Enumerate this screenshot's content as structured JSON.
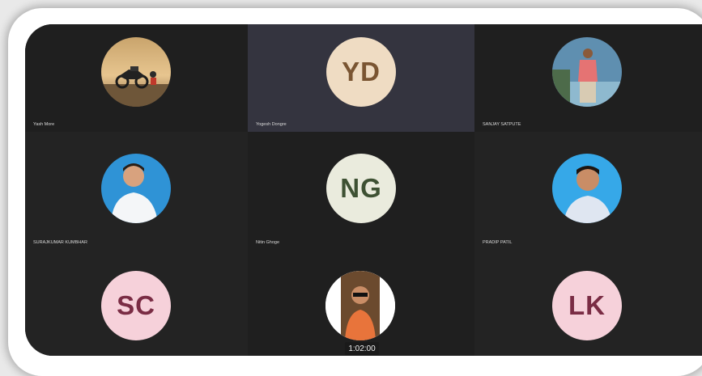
{
  "participants": [
    {
      "name": "Yash More",
      "initials": "",
      "avatar": "photo-motorbike"
    },
    {
      "name": "Yogesh Dongre",
      "initials": "YD",
      "avatar": "initials"
    },
    {
      "name": "SANJAY SATPUTE",
      "initials": "",
      "avatar": "photo-man-standing"
    },
    {
      "name": "SURAJKUMAR KUMBHAR",
      "initials": "",
      "avatar": "photo-man-smiling"
    },
    {
      "name": "Nitin Ghoge",
      "initials": "NG",
      "avatar": "initials"
    },
    {
      "name": "PRADIP PATIL",
      "initials": "",
      "avatar": "photo-man-portrait"
    },
    {
      "name": "",
      "initials": "SC",
      "avatar": "initials"
    },
    {
      "name": "",
      "initials": "",
      "avatar": "photo-man-sunglasses"
    },
    {
      "name": "",
      "initials": "LK",
      "avatar": "initials"
    }
  ],
  "timer": "1:02:00",
  "colors": {
    "yd_bg": "#efdcc3",
    "yd_fg": "#7a5532",
    "ng_bg": "#eaebdd",
    "ng_fg": "#3e5133",
    "sc_bg": "#f6d1da",
    "sc_fg": "#7a2c44",
    "lk_bg": "#f6d1da",
    "lk_fg": "#7a2c44"
  }
}
